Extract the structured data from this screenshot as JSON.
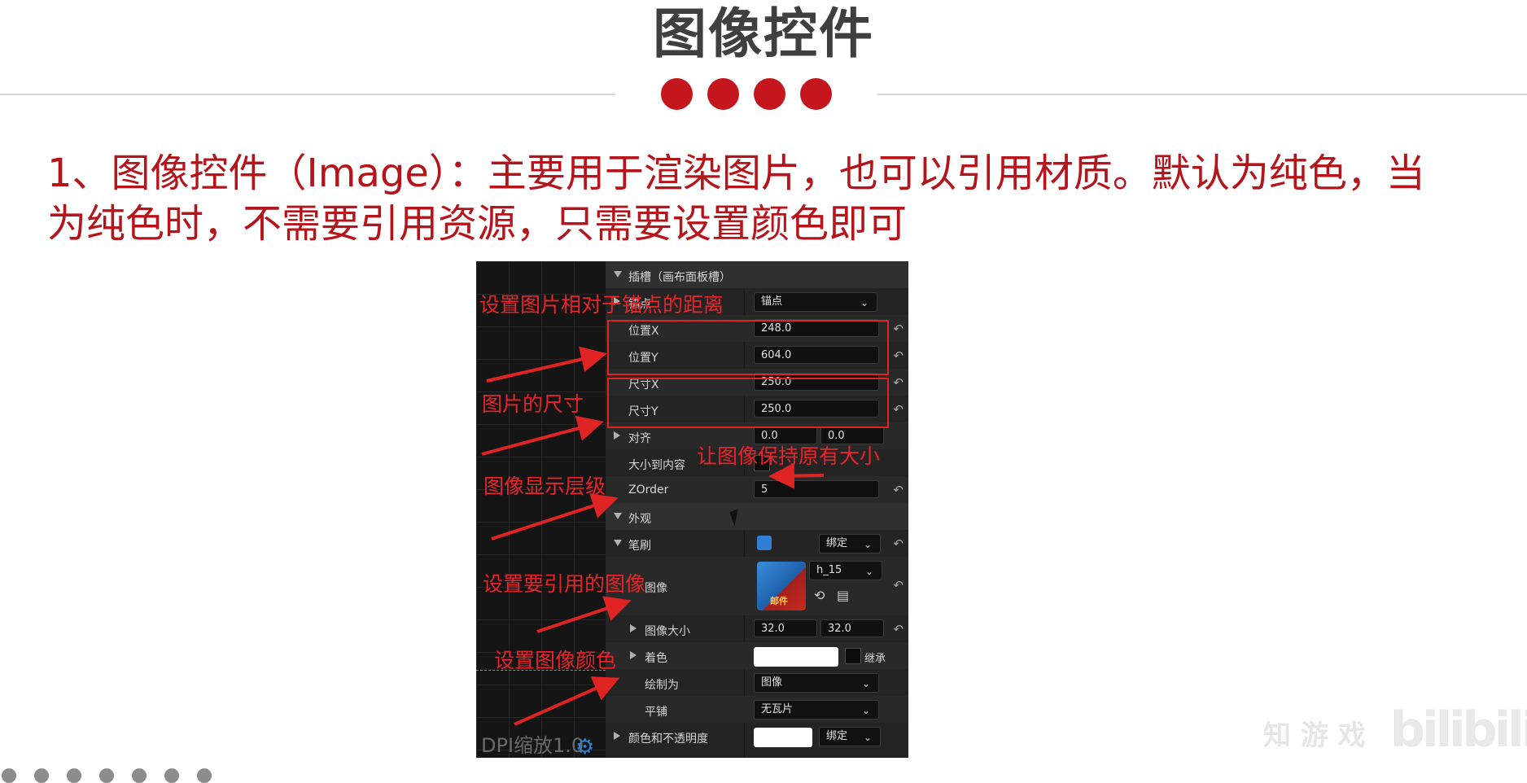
{
  "slide": {
    "title": "图像控件",
    "description_line1": "1、图像控件（Image）：主要用于渲染图片，也可以引用材质。默认为纯色，当",
    "description_line2": "为纯色时，不需要引用资源，只需要设置颜色即可",
    "accent_color": "#c4161c"
  },
  "canvas": {
    "dpi_label": "DPI缩放1.0",
    "settings_icon": "gear-icon"
  },
  "details": {
    "slot_category": "插槽（画布面板槽）",
    "anchor_label": "锚点",
    "anchor_value": "锚点",
    "position_x_label": "位置X",
    "position_x_value": "248.0",
    "position_y_label": "位置Y",
    "position_y_value": "604.0",
    "size_x_label": "尺寸X",
    "size_x_value": "250.0",
    "size_y_label": "尺寸Y",
    "size_y_value": "250.0",
    "alignment_label": "对齐",
    "alignment_x": "0.0",
    "alignment_y": "0.0",
    "size_to_content_label": "大小到内容",
    "zorder_label": "ZOrder",
    "zorder_value": "5",
    "appearance_category": "外观",
    "brush_label": "笔刷",
    "brush_bind": "绑定",
    "image_label": "图像",
    "image_asset": "h_15",
    "thumb_text": "邮件",
    "image_size_label": "图像大小",
    "image_size_x": "32.0",
    "image_size_y": "32.0",
    "tint_label": "着色",
    "inherit_label": "继承",
    "draw_as_label": "绘制为",
    "draw_as_value": "图像",
    "tiling_label": "平铺",
    "tiling_value": "无瓦片",
    "color_opacity_label": "颜色和不透明度",
    "color_bind": "绑定"
  },
  "annotations": {
    "anchor_distance": "设置图片相对于锚点的距离",
    "image_size": "图片的尺寸",
    "keep_original_size": "让图像保持原有大小",
    "display_layer": "图像显示层级",
    "reference_image": "设置要引用的图像",
    "image_color": "设置图像颜色",
    "annotation_color": "#e8242a"
  },
  "watermark": {
    "text": "知 游 戏",
    "logo": "bilibili"
  }
}
